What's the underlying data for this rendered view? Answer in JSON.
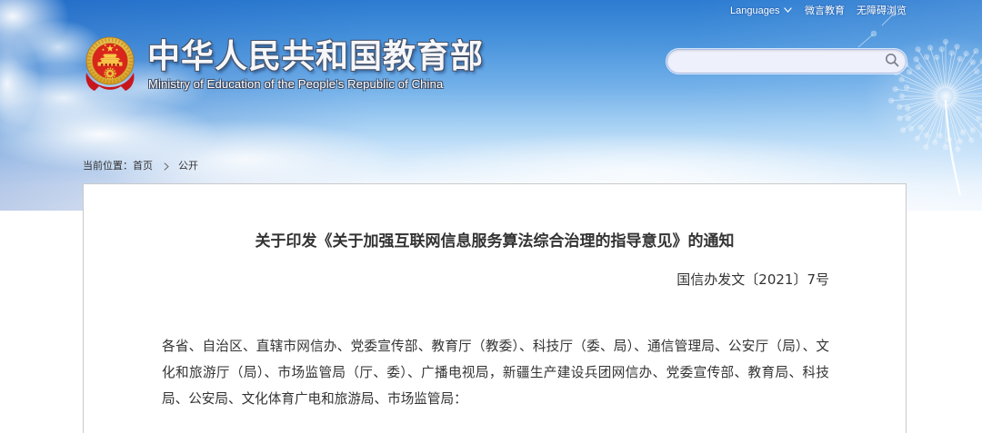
{
  "header": {
    "site_title": "中华人民共和国教育部",
    "site_subtitle": "Ministry of Education of the People's Republic of China",
    "top_links": {
      "languages": "Languages",
      "weiyan": "微言教育",
      "accessibility": "无障碍浏览"
    }
  },
  "breadcrumb": {
    "prefix": "当前位置：",
    "items": [
      "首页",
      "公开"
    ]
  },
  "article": {
    "title": "关于印发《关于加强互联网信息服务算法综合治理的指导意见》的通知",
    "doc_number": "国信办发文〔2021〕7号",
    "salutation": "各省、自治区、直辖市网信办、党委宣传部、教育厅（教委）、科技厅（委、局）、通信管理局、公安厅（局）、文化和旅游厅（局）、市场监管局（厅、委）、广播电视局，新疆生产建设兵团网信办、党委宣传部、教育局、科技局、公安局、文化体育广电和旅游局、市场监管局："
  },
  "icons": {
    "emblem": "national-emblem-logo",
    "languages_dropdown": "chevron-down-icon",
    "search": "search-icon",
    "breadcrumb_separator": "chevron-right-icon",
    "decoration": "dandelion"
  },
  "colors": {
    "body_text": "#333333",
    "panel_border": "#c9c9c9",
    "sky_blue": "#2c7bd1",
    "emblem_red": "#d9261c",
    "emblem_gold": "#e9b635"
  }
}
